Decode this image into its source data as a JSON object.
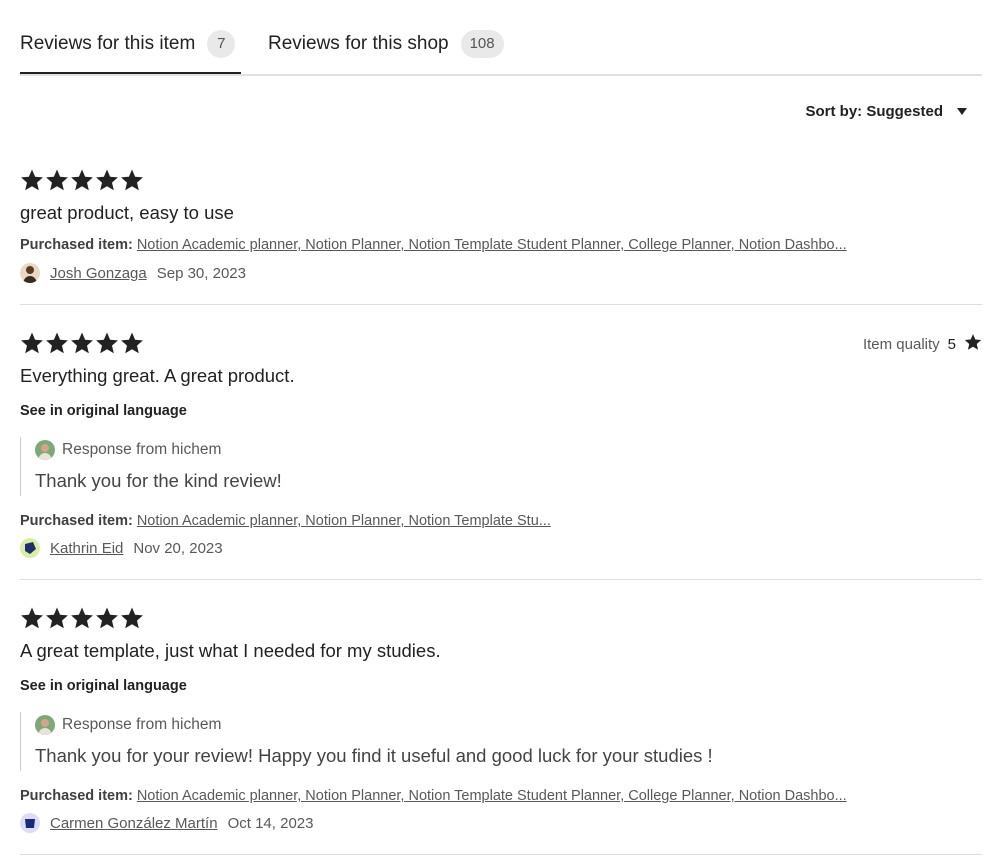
{
  "tabs": [
    {
      "label": "Reviews for this item",
      "count": "7"
    },
    {
      "label": "Reviews for this shop",
      "count": "108"
    }
  ],
  "sort": {
    "label": "Sort by: Suggested"
  },
  "reviews": [
    {
      "rating": 5,
      "text": "great product, easy to use",
      "purchased_label": "Purchased item:",
      "purchased_item": "Notion Academic planner, Notion Planner, Notion Template Student Planner, College Planner, Notion Dashbo...",
      "reviewer": "Josh Gonzaga",
      "date": "Sep 30, 2023"
    },
    {
      "rating": 5,
      "text": "Everything great. A great product.",
      "quality_label": "Item quality",
      "quality_value": "5",
      "see_original": "See in original language",
      "response_from": "Response from hichem",
      "response_text": "Thank you for the kind review!",
      "purchased_label": "Purchased item:",
      "purchased_item": "Notion Academic planner, Notion Planner, Notion Template Stu...",
      "reviewer": "Kathrin Eid",
      "date": "Nov 20, 2023"
    },
    {
      "rating": 5,
      "text": "A great template, just what I needed for my studies.",
      "see_original": "See in original language",
      "response_from": "Response from hichem",
      "response_text": "Thank you for your review! Happy you find it useful and good luck for your studies !",
      "purchased_label": "Purchased item:",
      "purchased_item": "Notion Academic planner, Notion Planner, Notion Template Student Planner, College Planner, Notion Dashbo...",
      "reviewer": "Carmen González Martín",
      "date": "Oct 14, 2023"
    }
  ],
  "colors": {
    "text": "#222222",
    "muted": "#595959",
    "divider": "#dedede",
    "count_bg": "#e9e9e9"
  },
  "icons": {
    "star": "star-icon",
    "caret": "caret-down-icon"
  }
}
